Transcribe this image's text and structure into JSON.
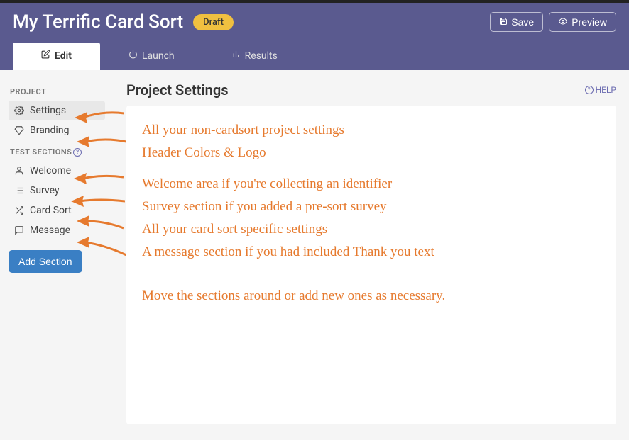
{
  "header": {
    "title": "My Terrific Card Sort",
    "badge": "Draft",
    "save_label": "Save",
    "preview_label": "Preview"
  },
  "tabs": {
    "edit": "Edit",
    "launch": "Launch",
    "results": "Results"
  },
  "sidebar": {
    "project_heading": "PROJECT",
    "test_sections_heading": "TEST SECTIONS",
    "items": {
      "settings": "Settings",
      "branding": "Branding",
      "welcome": "Welcome",
      "survey": "Survey",
      "cardsort": "Card Sort",
      "message": "Message"
    },
    "add_section": "Add Section"
  },
  "content": {
    "title": "Project Settings",
    "help": "HELP"
  },
  "annotations": {
    "a1": "All your non-cardsort project settings",
    "a2": "Header Colors & Logo",
    "a3": "Welcome area if you're collecting an identifier",
    "a4": "Survey section if you added a pre-sort survey",
    "a5": "All your card sort specific settings",
    "a6": "A message section if you had included Thank you text",
    "a7": "Move the sections around or add new ones as necessary."
  },
  "colors": {
    "accent_orange": "#e67a2e",
    "header_purple": "#5a5a8f",
    "badge_yellow": "#f0c040",
    "button_blue": "#3a7fc4"
  }
}
